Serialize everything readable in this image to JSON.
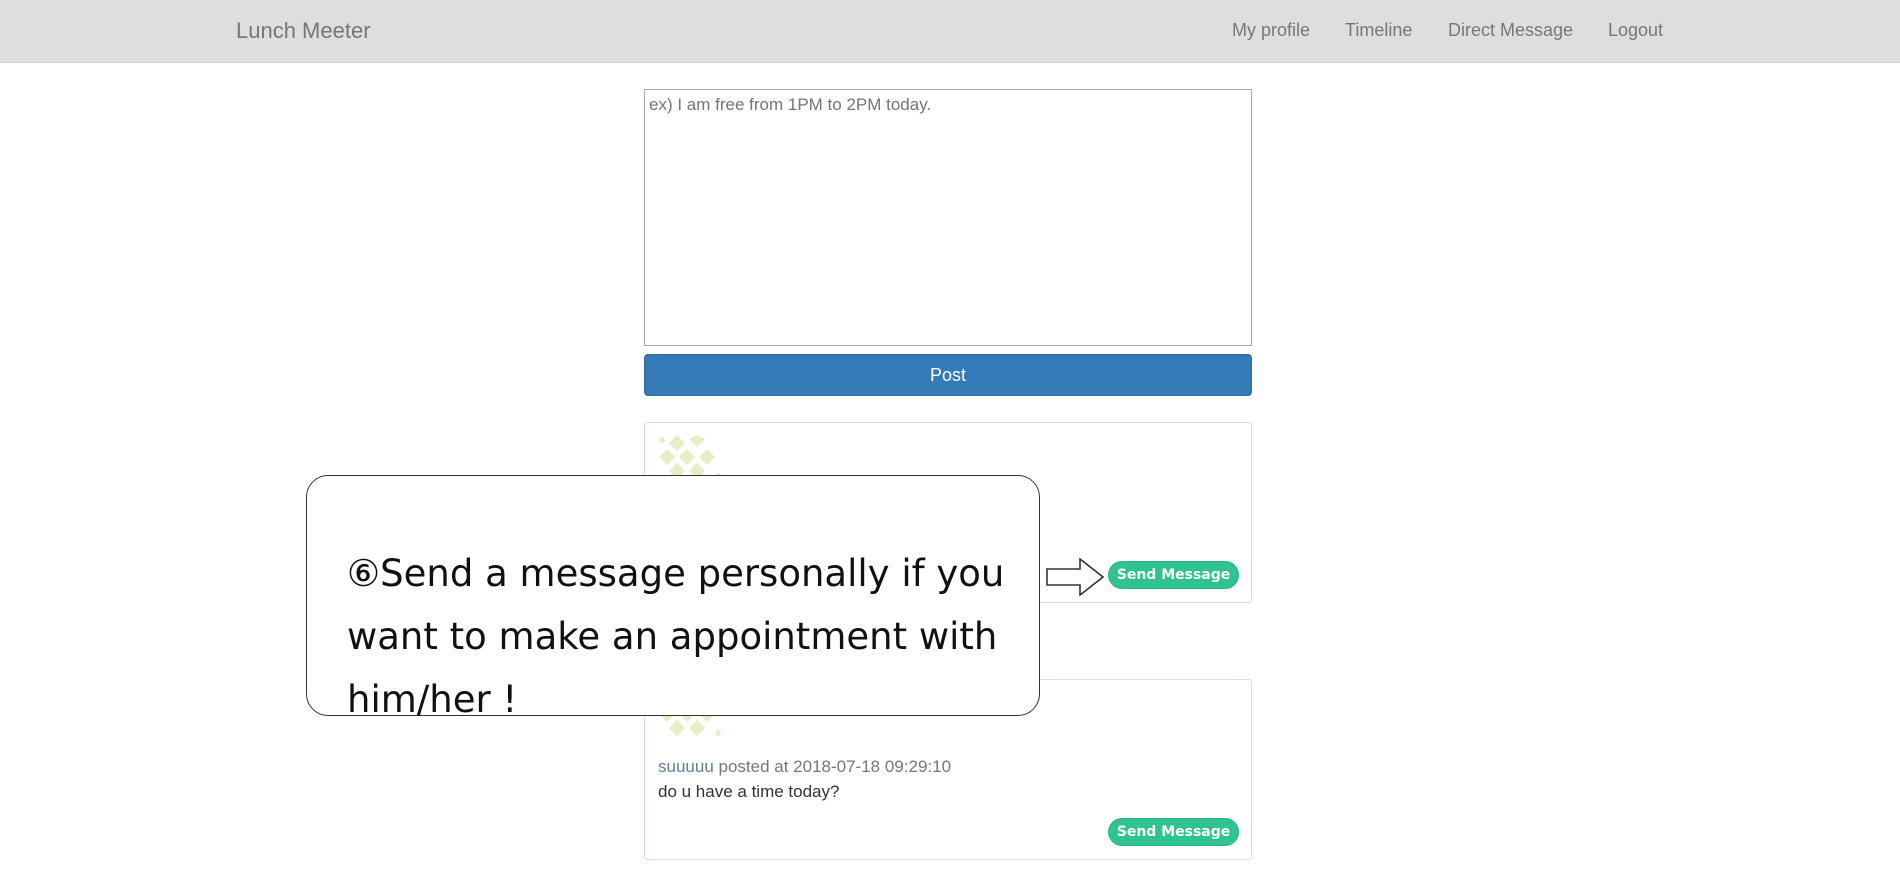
{
  "navbar": {
    "brand": "Lunch Meeter",
    "links": [
      {
        "label": "My profile"
      },
      {
        "label": "Timeline"
      },
      {
        "label": "Direct Message"
      },
      {
        "label": "Logout"
      }
    ]
  },
  "composer": {
    "placeholder": "ex) I am free from 1PM to 2PM today.",
    "value": "",
    "post_label": "Post"
  },
  "posts": [
    {
      "user": "",
      "meta": "",
      "body": "",
      "send_label": "Send Message"
    },
    {
      "user": "suuuuu",
      "meta": " posted at 2018-07-18 09:29:10",
      "body": "do u have a time today?",
      "send_label": "Send Message"
    }
  ],
  "callout": {
    "text": "⑥Send a message personally if you want to make an appointment with him/her !"
  },
  "colors": {
    "navbar_bg": "#dedede",
    "primary": "#337ab7",
    "send_button": "#2fc48f",
    "card_border": "#cde3e6",
    "avatar": "#e4efc6"
  },
  "icons": {
    "avatar": "identicon-avatar",
    "arrow": "right-arrow-icon"
  }
}
